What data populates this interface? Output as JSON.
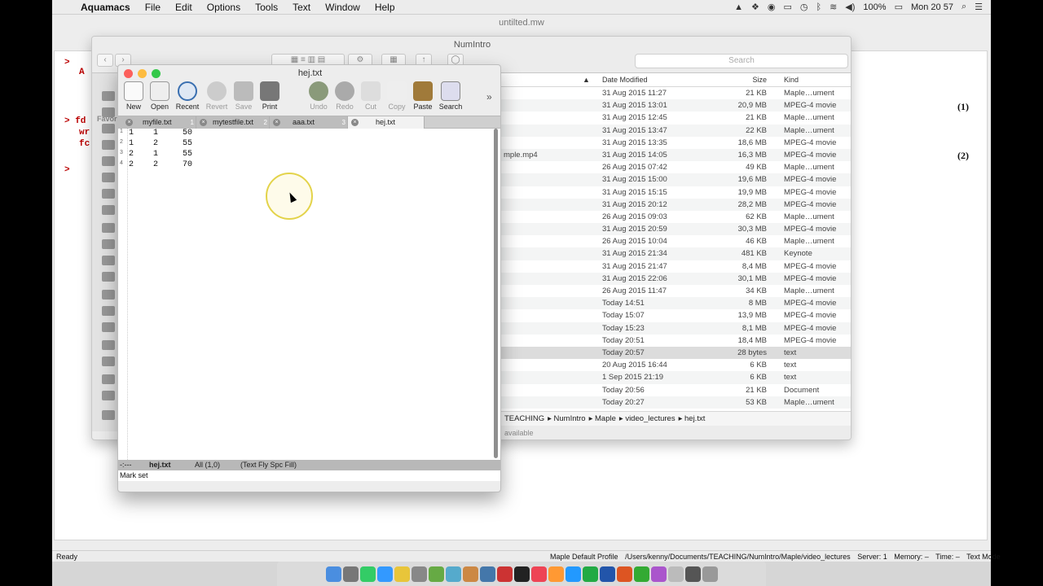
{
  "menubar": {
    "app": "Aquamacs",
    "items": [
      "File",
      "Edit",
      "Options",
      "Tools",
      "Text",
      "Window",
      "Help"
    ],
    "battery": "100%",
    "clock": "Mon 20 57"
  },
  "maple": {
    "title": "untilted.mw",
    "prompts": [
      ">",
      "A",
      "> fd",
      "wr",
      "fc",
      ">"
    ],
    "labels": [
      "(1)",
      "(2)"
    ],
    "status": {
      "left": "Ready",
      "profile": "Maple Default Profile",
      "path": "/Users/kenny/Documents/TEACHING/NumIntro/Maple/video_lectures",
      "server": "Server: 1",
      "memory": "Memory: –",
      "time": "Time: –",
      "mode": "Text Mode"
    }
  },
  "finder": {
    "title": "NumIntro",
    "search_placeholder": "Search",
    "favorites_label": "Favor",
    "columns": {
      "date": "Date Modified",
      "size": "Size",
      "kind": "Kind"
    },
    "rows": [
      {
        "name": "",
        "date": "31 Aug 2015 11:27",
        "size": "21 KB",
        "kind": "Maple…ument"
      },
      {
        "name": "",
        "date": "31 Aug 2015 13:01",
        "size": "20,9 MB",
        "kind": "MPEG-4 movie"
      },
      {
        "name": "",
        "date": "31 Aug 2015 12:45",
        "size": "21 KB",
        "kind": "Maple…ument"
      },
      {
        "name": "",
        "date": "31 Aug 2015 13:47",
        "size": "22 KB",
        "kind": "Maple…ument"
      },
      {
        "name": "",
        "date": "31 Aug 2015 13:35",
        "size": "18,6 MB",
        "kind": "MPEG-4 movie"
      },
      {
        "name": "mple.mp4",
        "date": "31 Aug 2015 14:05",
        "size": "16,3 MB",
        "kind": "MPEG-4 movie"
      },
      {
        "name": "",
        "date": "26 Aug 2015 07:42",
        "size": "49 KB",
        "kind": "Maple…ument"
      },
      {
        "name": "",
        "date": "31 Aug 2015 15:00",
        "size": "19,6 MB",
        "kind": "MPEG-4 movie"
      },
      {
        "name": "",
        "date": "31 Aug 2015 15:15",
        "size": "19,9 MB",
        "kind": "MPEG-4 movie"
      },
      {
        "name": "",
        "date": "31 Aug 2015 20:12",
        "size": "28,2 MB",
        "kind": "MPEG-4 movie"
      },
      {
        "name": "",
        "date": "26 Aug 2015 09:03",
        "size": "62 KB",
        "kind": "Maple…ument"
      },
      {
        "name": "",
        "date": "31 Aug 2015 20:59",
        "size": "30,3 MB",
        "kind": "MPEG-4 movie"
      },
      {
        "name": "",
        "date": "26 Aug 2015 10:04",
        "size": "46 KB",
        "kind": "Maple…ument"
      },
      {
        "name": "",
        "date": "31 Aug 2015 21:34",
        "size": "481 KB",
        "kind": "Keynote"
      },
      {
        "name": "",
        "date": "31 Aug 2015 21:47",
        "size": "8,4 MB",
        "kind": "MPEG-4 movie"
      },
      {
        "name": "",
        "date": "31 Aug 2015 22:06",
        "size": "30,1 MB",
        "kind": "MPEG-4 movie"
      },
      {
        "name": "",
        "date": "26 Aug 2015 11:47",
        "size": "34 KB",
        "kind": "Maple…ument"
      },
      {
        "name": "",
        "date": "Today 14:51",
        "size": "8 MB",
        "kind": "MPEG-4 movie"
      },
      {
        "name": "",
        "date": "Today 15:07",
        "size": "13,9 MB",
        "kind": "MPEG-4 movie"
      },
      {
        "name": "",
        "date": "Today 15:23",
        "size": "8,1 MB",
        "kind": "MPEG-4 movie"
      },
      {
        "name": "",
        "date": "Today 20:51",
        "size": "18,4 MB",
        "kind": "MPEG-4 movie"
      },
      {
        "name": "",
        "date": "Today 20:57",
        "size": "28 bytes",
        "kind": "text",
        "selected": true
      },
      {
        "name": "",
        "date": "20 Aug 2015 16:44",
        "size": "6 KB",
        "kind": "text"
      },
      {
        "name": "",
        "date": "1 Sep 2015 21:19",
        "size": "6 KB",
        "kind": "text"
      },
      {
        "name": "",
        "date": "Today 20:56",
        "size": "21 KB",
        "kind": "Document"
      },
      {
        "name": "",
        "date": "Today 20:27",
        "size": "53 KB",
        "kind": "Maple…ument"
      }
    ],
    "path": [
      "TEACHING",
      "NumIntro",
      "Maple",
      "video_lectures",
      "hej.txt"
    ],
    "status": "available"
  },
  "aquamacs": {
    "title": "hej.txt",
    "toolbar": [
      "New",
      "Open",
      "Recent",
      "Revert",
      "Save",
      "Print",
      "Undo",
      "Redo",
      "Cut",
      "Copy",
      "Paste",
      "Search"
    ],
    "tabs": [
      {
        "label": "myfile.txt",
        "num": "1"
      },
      {
        "label": "mytestfile.txt",
        "num": "2"
      },
      {
        "label": "aaa.txt",
        "num": "3"
      },
      {
        "label": "hej.txt",
        "num": ""
      }
    ],
    "lines": [
      {
        "n": "1",
        "text": "1    1     50"
      },
      {
        "n": "2",
        "text": "1    2     55"
      },
      {
        "n": "3",
        "text": "2    1     55"
      },
      {
        "n": "4",
        "text": "2    2     70"
      }
    ],
    "modeline": {
      "flags": "-:---",
      "buffer": "hej.txt",
      "pos": "All (1,0)",
      "mode": "(Text Fly Spc Fill)"
    },
    "minibuffer": "Mark set"
  }
}
